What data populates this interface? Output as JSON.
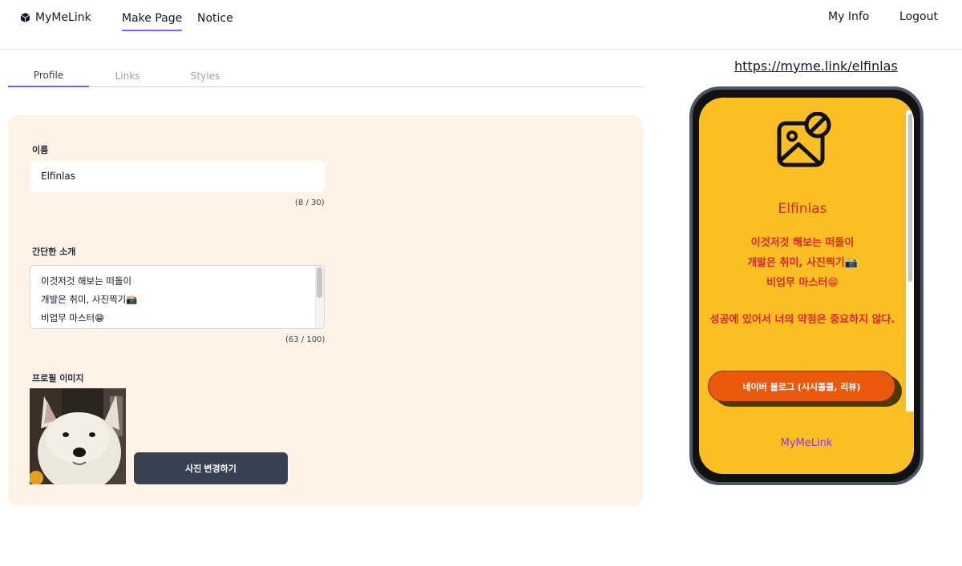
{
  "nav": {
    "brand": "MyMeLink",
    "items": [
      "Make Page",
      "Notice"
    ],
    "right": [
      "My Info",
      "Logout"
    ]
  },
  "tabs": [
    "Profile",
    "Links",
    "Styles"
  ],
  "form": {
    "name_label": "이름",
    "name_value": "Elfinlas",
    "name_count": "(8 / 30)",
    "bio_label": "간단한 소개",
    "bio_lines": [
      "이것저것 해보는 떠돌이",
      "개발은 취미, 사진찍기📸",
      "비업무 마스터😁"
    ],
    "bio_count": "(63 / 100)",
    "image_label": "프로필 이미지",
    "change_button": "사진 변경하기"
  },
  "preview": {
    "url": "https://myme.link/elfinlas",
    "name": "Elfinlas",
    "bio_lines": [
      "이것저것 해보는 떠돌이",
      "개발은 취미, 사진찍기📸",
      "비업무 마스터😁"
    ],
    "quote": "성공에 있어서 너의 약점은 중요하지 않다.",
    "link_button": "네이버 블로그 (시시콜콜, 리뷰)",
    "footer": "MyMeLink"
  },
  "colors": {
    "accent": "#8b5cf6",
    "panel_bg": "#fff3e8",
    "phone_bg": "#fbbf24",
    "preview_text": "#dc2626",
    "link_bg": "#ea580c",
    "footer_text": "#9333ea"
  }
}
